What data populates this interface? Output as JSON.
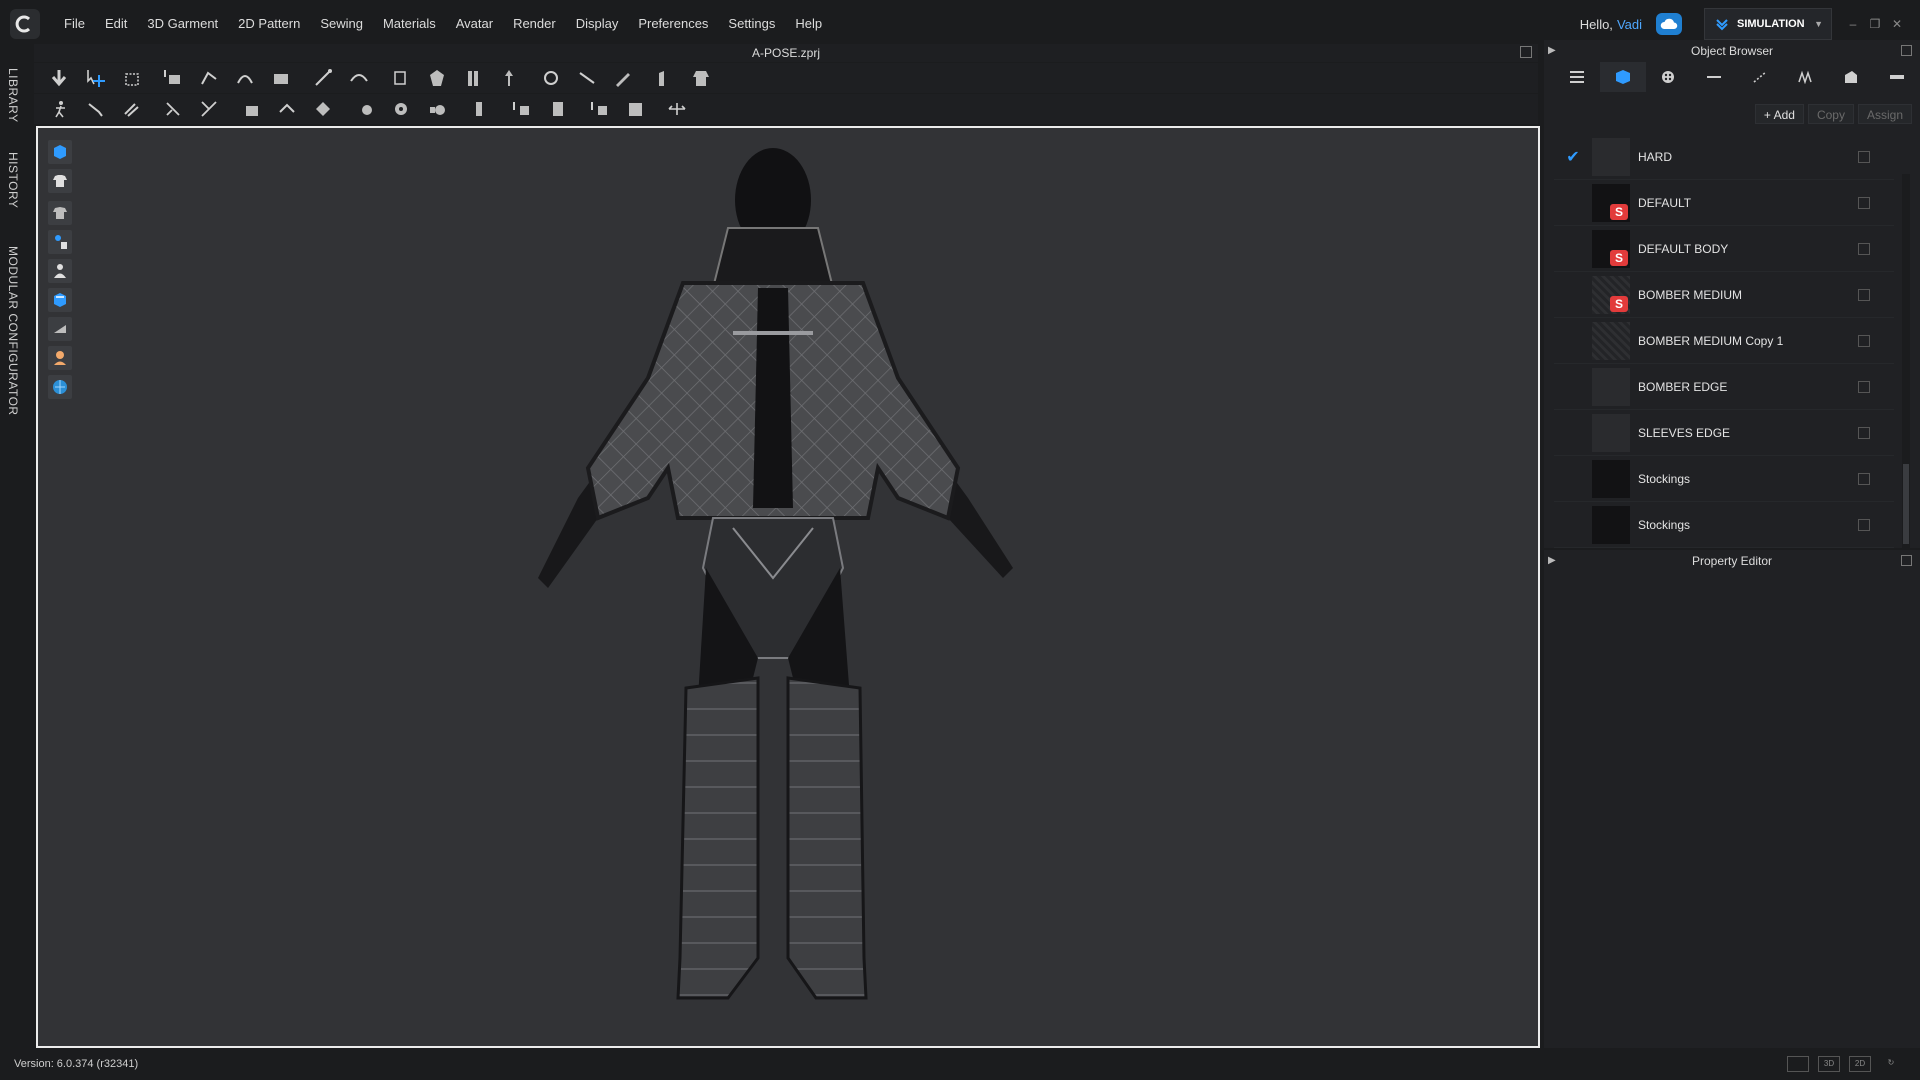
{
  "menubar": {
    "items": [
      "File",
      "Edit",
      "3D Garment",
      "2D Pattern",
      "Sewing",
      "Materials",
      "Avatar",
      "Render",
      "Display",
      "Preferences",
      "Settings",
      "Help"
    ],
    "greeting_prefix": "Hello,",
    "username": "Vadi",
    "mode_label": "SIMULATION",
    "accent_color": "#2f9bff"
  },
  "left_tabs": [
    "LIBRARY",
    "HISTORY",
    "MODULAR CONFIGURATOR"
  ],
  "viewport": {
    "file_title": "A-POSE.zprj"
  },
  "object_browser": {
    "title": "Object Browser",
    "actions": {
      "add": "+ Add",
      "copy": "Copy",
      "assign": "Assign"
    },
    "materials": [
      {
        "name": "HARD",
        "checked": true,
        "thumb": "plain",
        "badge": false
      },
      {
        "name": "DEFAULT",
        "checked": false,
        "thumb": "dark",
        "badge": true
      },
      {
        "name": "DEFAULT BODY",
        "checked": false,
        "thumb": "dark",
        "badge": true
      },
      {
        "name": "BOMBER MEDIUM",
        "checked": false,
        "thumb": "speckle",
        "badge": true
      },
      {
        "name": "BOMBER MEDIUM Copy 1",
        "checked": false,
        "thumb": "speckle",
        "badge": false
      },
      {
        "name": "BOMBER EDGE",
        "checked": false,
        "thumb": "plain",
        "badge": false
      },
      {
        "name": "SLEEVES EDGE",
        "checked": false,
        "thumb": "plain",
        "badge": false
      },
      {
        "name": "Stockings",
        "checked": false,
        "thumb": "dark",
        "badge": false
      },
      {
        "name": "Stockings",
        "checked": false,
        "thumb": "dark",
        "badge": false
      }
    ]
  },
  "property_editor": {
    "title": "Property Editor"
  },
  "statusbar": {
    "version": "Version: 6.0.374 (r32341)",
    "view_modes": [
      "",
      "3D",
      "2D",
      "↻"
    ]
  }
}
